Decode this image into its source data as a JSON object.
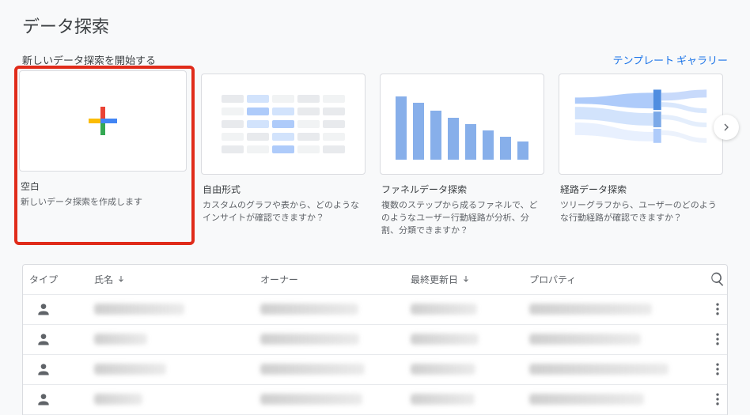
{
  "title": "データ探索",
  "subtitle": "新しいデータ探索を開始する",
  "gallery_link": "テンプレート ギャラリー",
  "cards": [
    {
      "title": "空白",
      "desc": "新しいデータ探索を作成します"
    },
    {
      "title": "自由形式",
      "desc": "カスタムのグラフや表から、どのようなインサイトが確認できますか？"
    },
    {
      "title": "ファネルデータ探索",
      "desc": "複数のステップから成るファネルで、どのようなユーザー行動経路が分析、分割、分類できますか？"
    },
    {
      "title": "経路データ探索",
      "desc": "ツリーグラフから、ユーザーのどのような行動経路が確認できますか？"
    }
  ],
  "columns": {
    "type": "タイプ",
    "name": "氏名",
    "owner": "オーナー",
    "updated": "最終更新日",
    "property": "プロパティ"
  },
  "chart_data": {
    "type": "bar",
    "title": "",
    "xlabel": "",
    "ylabel": "",
    "categories": [
      "1",
      "2",
      "3",
      "4",
      "5",
      "6",
      "7",
      "8"
    ],
    "values": [
      78,
      70,
      60,
      52,
      44,
      36,
      28,
      22
    ],
    "ylim": [
      0,
      80
    ]
  },
  "rows": 4
}
